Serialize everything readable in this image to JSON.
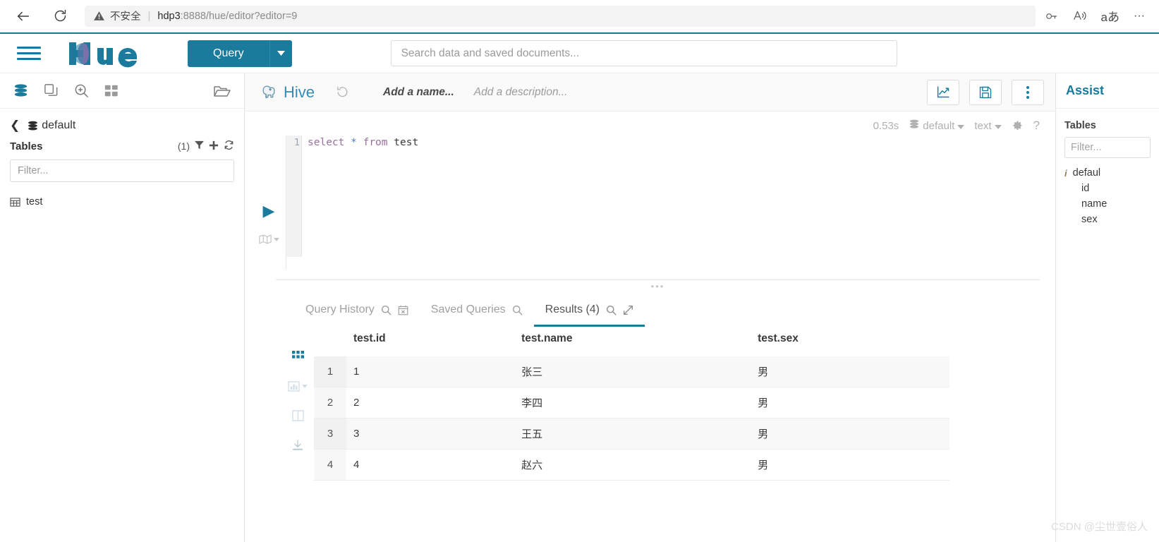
{
  "browser": {
    "back_icon": "arrow-left-icon",
    "reload_icon": "reload-icon",
    "security_warning": "不安全",
    "url_host": "hdp3",
    "url_rest": ":8888/hue/editor?editor=9",
    "separator": "|",
    "right_icons": [
      "key-icon",
      "read-aloud-icon",
      "translate-icon",
      "more-icon"
    ]
  },
  "header": {
    "menu_icon": "hamburger-menu-icon",
    "logo_text": "hue",
    "query_label": "Query",
    "query_caret_icon": "caret-down-icon",
    "search_placeholder": "Search data and saved documents..."
  },
  "left_panel": {
    "icons": [
      "database-icon",
      "documents-icon",
      "search-zoom-icon",
      "apps-grid-icon",
      "open-folder-icon"
    ],
    "breadcrumb": {
      "back_icon": "chevron-left-icon",
      "db_icon": "database-icon",
      "db_name": "default"
    },
    "tables_title": "Tables",
    "tables_count": "(1)",
    "tables_actions": [
      "filter-icon",
      "plus-icon",
      "refresh-icon"
    ],
    "filter_placeholder": "Filter...",
    "tables": [
      {
        "icon": "table-icon",
        "name": "test"
      }
    ]
  },
  "editor": {
    "engine_icon": "hive-elephant-icon",
    "engine_name": "Hive",
    "history_icon": "history-revert-icon",
    "name_placeholder": "Add a name...",
    "description_placeholder": "Add a description...",
    "toolbar": [
      {
        "name": "chart-icon",
        "label": "chart"
      },
      {
        "name": "save-icon",
        "label": "save"
      },
      {
        "name": "kebab-menu-icon",
        "label": "more"
      }
    ],
    "meta": {
      "duration": "0.53s",
      "database_icon": "database-icon",
      "database": "default",
      "format": "text",
      "caret_icon": "caret-down-icon",
      "settings_icon": "gear-icon",
      "help_icon": "question-mark-icon"
    },
    "run_icon": "play-triangle-icon",
    "map_icon": "map-icon",
    "line_number": "1",
    "sql": {
      "token_select": "select",
      "token_star": "*",
      "token_from": "from",
      "token_table": "test",
      "full": "select * from test"
    },
    "split_handle": "•••"
  },
  "results": {
    "tabs": [
      {
        "label": "Query History",
        "icons": [
          "search-icon",
          "calendar-clear-icon"
        ],
        "active": false
      },
      {
        "label": "Saved Queries",
        "icons": [
          "search-icon"
        ],
        "active": false
      },
      {
        "label": "Results (4)",
        "icons": [
          "search-icon",
          "expand-icon"
        ],
        "active": true
      }
    ],
    "gutter_icons": [
      "grid-view-icon",
      "chart-view-icon",
      "columns-view-icon",
      "download-icon"
    ],
    "columns": [
      "",
      "test.id",
      "test.name",
      "test.sex"
    ],
    "rows": [
      {
        "num": "1",
        "id": "1",
        "name": "张三",
        "sex": "男"
      },
      {
        "num": "2",
        "id": "2",
        "name": "李四",
        "sex": "男"
      },
      {
        "num": "3",
        "id": "3",
        "name": "王五",
        "sex": "男"
      },
      {
        "num": "4",
        "id": "4",
        "name": "赵六",
        "sex": "男"
      }
    ]
  },
  "right_panel": {
    "title": "Assist",
    "section_title": "Tables",
    "filter_placeholder": "Filter...",
    "tree": {
      "root_icon": "info-icon",
      "root_label": "defaul",
      "children": [
        "id",
        "name",
        "sex"
      ]
    }
  },
  "watermark": "CSDN @尘世壹俗人",
  "colors": {
    "brand": "#1a7b9c",
    "accent_purple": "#9b6fa0",
    "text": "#3a3a3a",
    "muted": "#9b9b9b"
  }
}
